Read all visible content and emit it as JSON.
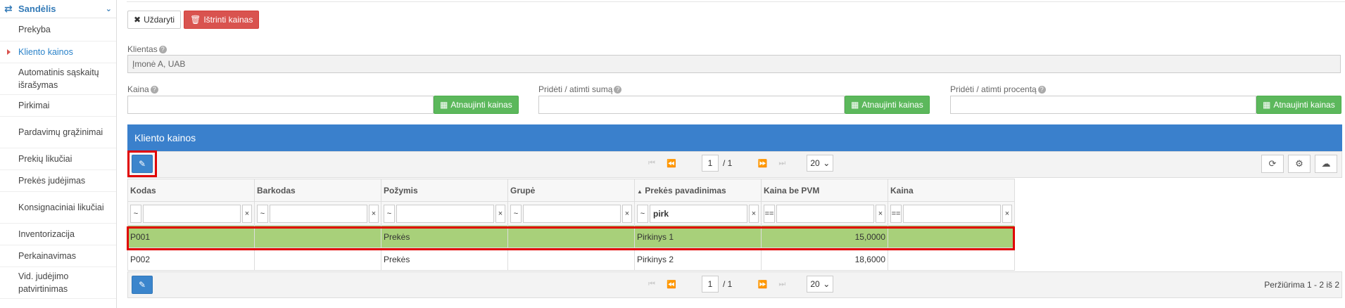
{
  "sidebar": {
    "header": "Sandėlis",
    "items": [
      {
        "label": "Prekyba"
      },
      {
        "label": "Kliento kainos"
      },
      {
        "label": "Automatinis sąskaitų išrašymas"
      },
      {
        "label": "Pirkimai"
      },
      {
        "label": "Pardavimų grąžinimai"
      },
      {
        "label": "Prekių likučiai"
      },
      {
        "label": "Prekės judėjimas"
      },
      {
        "label": "Konsignaciniai likučiai"
      },
      {
        "label": "Inventorizacija"
      },
      {
        "label": "Perkainavimas"
      },
      {
        "label": "Vid. judėjimo patvirtinimas"
      }
    ]
  },
  "toolbar": {
    "close_label": "Uždaryti",
    "delete_label": "Ištrinti kainas"
  },
  "form": {
    "client_label": "Klientas",
    "client_value": "Įmonė A, UAB",
    "price_label": "Kaina",
    "add_sum_label": "Pridėti / atimti sumą",
    "add_percent_label": "Pridėti / atimti procentą",
    "update_label": "Atnaujinti kainas"
  },
  "panel": {
    "title": "Kliento kainos"
  },
  "pager": {
    "page": "1",
    "total": "/ 1",
    "size": "20"
  },
  "grid": {
    "columns": [
      "Kodas",
      "Barkodas",
      "Požymis",
      "Grupė",
      "Prekės pavadinimas",
      "Kaina be PVM",
      "Kaina"
    ],
    "filters": [
      {
        "op": "~",
        "value": ""
      },
      {
        "op": "~",
        "value": ""
      },
      {
        "op": "~",
        "value": ""
      },
      {
        "op": "~",
        "value": ""
      },
      {
        "op": "~",
        "value": "pirk"
      },
      {
        "op": "==",
        "value": ""
      },
      {
        "op": "==",
        "value": ""
      }
    ],
    "rows": [
      {
        "code": "P001",
        "barcode": "",
        "type": "Prekės",
        "group": "",
        "name": "Pirkinys 1",
        "price_net": "15,0000",
        "price": ""
      },
      {
        "code": "P002",
        "barcode": "",
        "type": "Prekės",
        "group": "",
        "name": "Pirkinys 2",
        "price_net": "18,6000",
        "price": ""
      }
    ],
    "sorted_column_marker": "▲"
  },
  "footer": {
    "info": "Peržiūrima 1 - 2 iš 2"
  },
  "colors": {
    "accent_blue": "#3a80cc",
    "danger_red": "#d9534f",
    "success_green": "#5cb85c",
    "selected_row": "#a8d07a",
    "highlight_outline": "#e00000"
  }
}
